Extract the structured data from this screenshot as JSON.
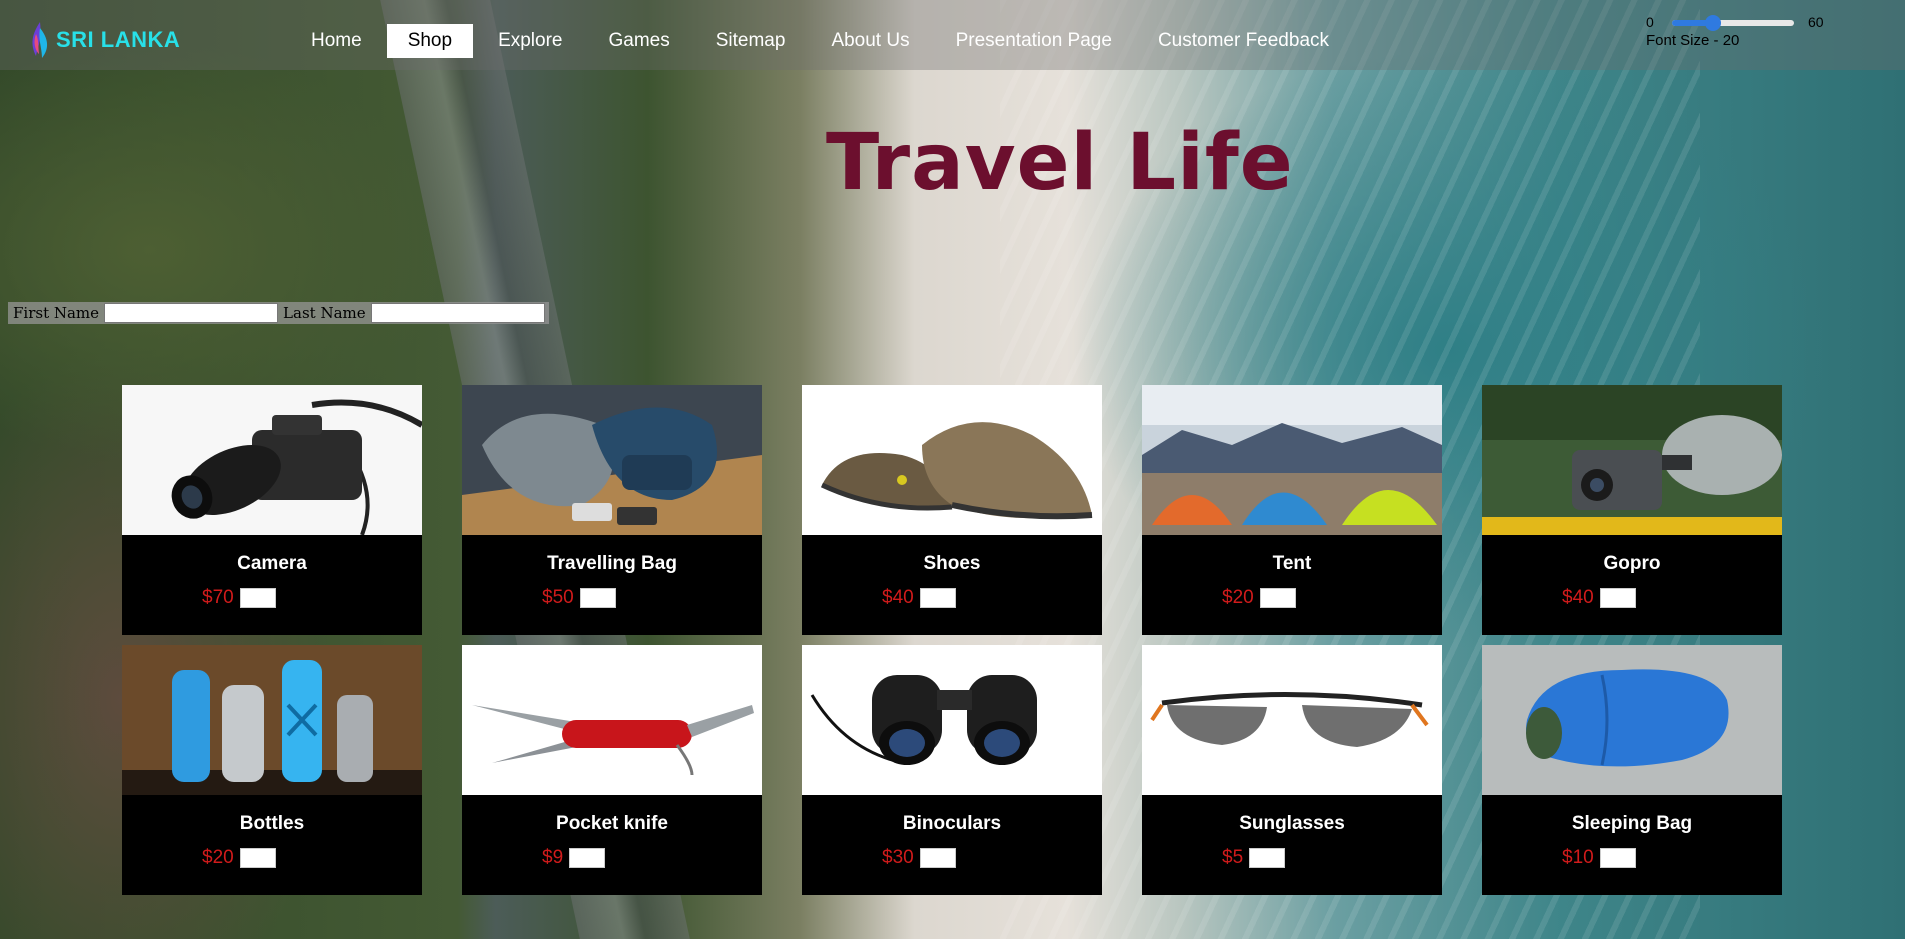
{
  "brand": {
    "name": "SRI LANKA"
  },
  "nav": {
    "items": [
      {
        "label": "Home",
        "active": false
      },
      {
        "label": "Shop",
        "active": true
      },
      {
        "label": "Explore",
        "active": false
      },
      {
        "label": "Games",
        "active": false
      },
      {
        "label": "Sitemap",
        "active": false
      },
      {
        "label": "About Us",
        "active": false
      },
      {
        "label": "Presentation Page",
        "active": false
      },
      {
        "label": "Customer Feedback",
        "active": false
      }
    ]
  },
  "font_control": {
    "min": "0",
    "max": "60",
    "value": 20,
    "label": "Font Size - 20"
  },
  "hero": {
    "title": "Travel Life"
  },
  "form": {
    "first_name_label": "First Name",
    "last_name_label": "Last Name"
  },
  "products": [
    {
      "name": "Camera",
      "price": "$70",
      "icon": "camera-icon"
    },
    {
      "name": "Travelling Bag",
      "price": "$50",
      "icon": "backpack-icon"
    },
    {
      "name": "Shoes",
      "price": "$40",
      "icon": "shoe-icon"
    },
    {
      "name": "Tent",
      "price": "$20",
      "icon": "tent-icon"
    },
    {
      "name": "Gopro",
      "price": "$40",
      "icon": "action-camera-icon"
    },
    {
      "name": "Bottles",
      "price": "$20",
      "icon": "bottles-icon"
    },
    {
      "name": "Pocket knife",
      "price": "$9",
      "icon": "pocket-knife-icon"
    },
    {
      "name": "Binoculars",
      "price": "$30",
      "icon": "binoculars-icon"
    },
    {
      "name": "Sunglasses",
      "price": "$5",
      "icon": "sunglasses-icon"
    },
    {
      "name": "Sleeping Bag",
      "price": "$10",
      "icon": "sleeping-bag-icon"
    }
  ],
  "colors": {
    "accent": "#28e0e8",
    "title": "#6c0f2e",
    "price": "#d11b1b",
    "slider": "#2f7ae0"
  }
}
